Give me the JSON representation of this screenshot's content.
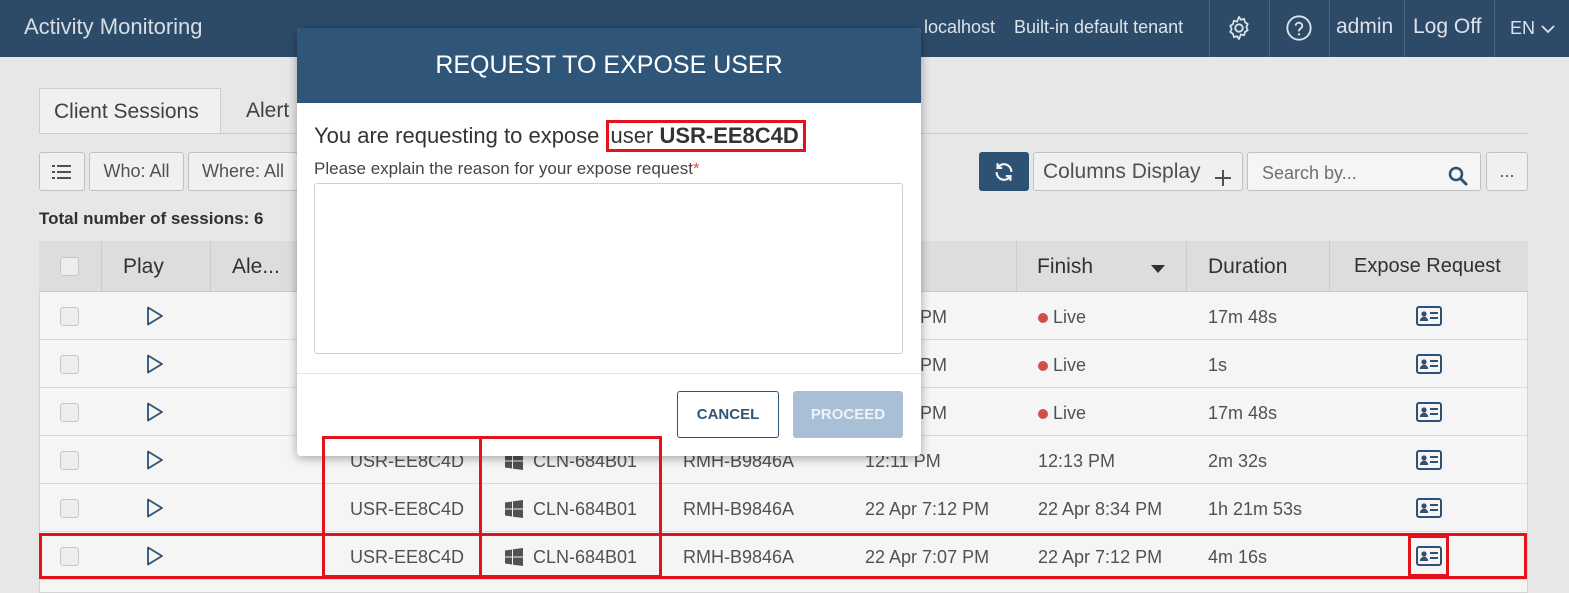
{
  "header": {
    "app_title": "Activity Monitoring",
    "server": "localhost",
    "tenant": "Built-in default tenant",
    "user": "admin",
    "logoff": "Log Off",
    "language": "EN"
  },
  "tabs": [
    {
      "label": "Client Sessions"
    },
    {
      "label": "Alert"
    }
  ],
  "filters": {
    "who": "Who: All",
    "where": "Where: All",
    "columns_display": "Columns Display",
    "search_placeholder": "Search by...",
    "more": "..."
  },
  "summary": {
    "total": "Total number of sessions: 6"
  },
  "table": {
    "headers": {
      "play": "Play",
      "alerts": "Ale...",
      "finish": "Finish",
      "duration": "Duration",
      "expose": "Expose Request"
    },
    "rows": [
      {
        "user": "",
        "client": "",
        "server": "",
        "start": "PM",
        "finish": "Live",
        "duration": "17m 48s"
      },
      {
        "user": "",
        "client": "",
        "server": "",
        "start": "PM",
        "finish": "Live",
        "duration": "1s"
      },
      {
        "user": "",
        "client": "",
        "server": "",
        "start": "PM",
        "finish": "Live",
        "duration": "17m 48s"
      },
      {
        "user": "USR-EE8C4D",
        "client": "CLN-684B01",
        "server": "RMH-B9846A",
        "start": "12:11 PM",
        "finish": "12:13 PM",
        "duration": "2m 32s"
      },
      {
        "user": "USR-EE8C4D",
        "client": "CLN-684B01",
        "server": "RMH-B9846A",
        "start": "22 Apr 7:12 PM",
        "finish": "22 Apr 8:34 PM",
        "duration": "1h 21m 53s"
      },
      {
        "user": "USR-EE8C4D",
        "client": "CLN-684B01",
        "server": "RMH-B9846A",
        "start": "22 Apr 7:07 PM",
        "finish": "22 Apr 7:12 PM",
        "duration": "4m 16s"
      }
    ]
  },
  "modal": {
    "title": "REQUEST TO EXPOSE USER",
    "message_prefix": "You are requesting to expose ",
    "message_user_word": "user ",
    "message_user_id": "USR-EE8C4D",
    "reason_label": "Please explain the reason for your expose request",
    "required_mark": "*",
    "cancel": "CANCEL",
    "proceed": "PROCEED"
  },
  "colors": {
    "header_bg": "#2f4f6e",
    "modal_header_bg": "#2f5679",
    "live_dot": "#d9534f",
    "highlight": "#e3121b",
    "proceed_disabled": "#a9bfd6"
  }
}
